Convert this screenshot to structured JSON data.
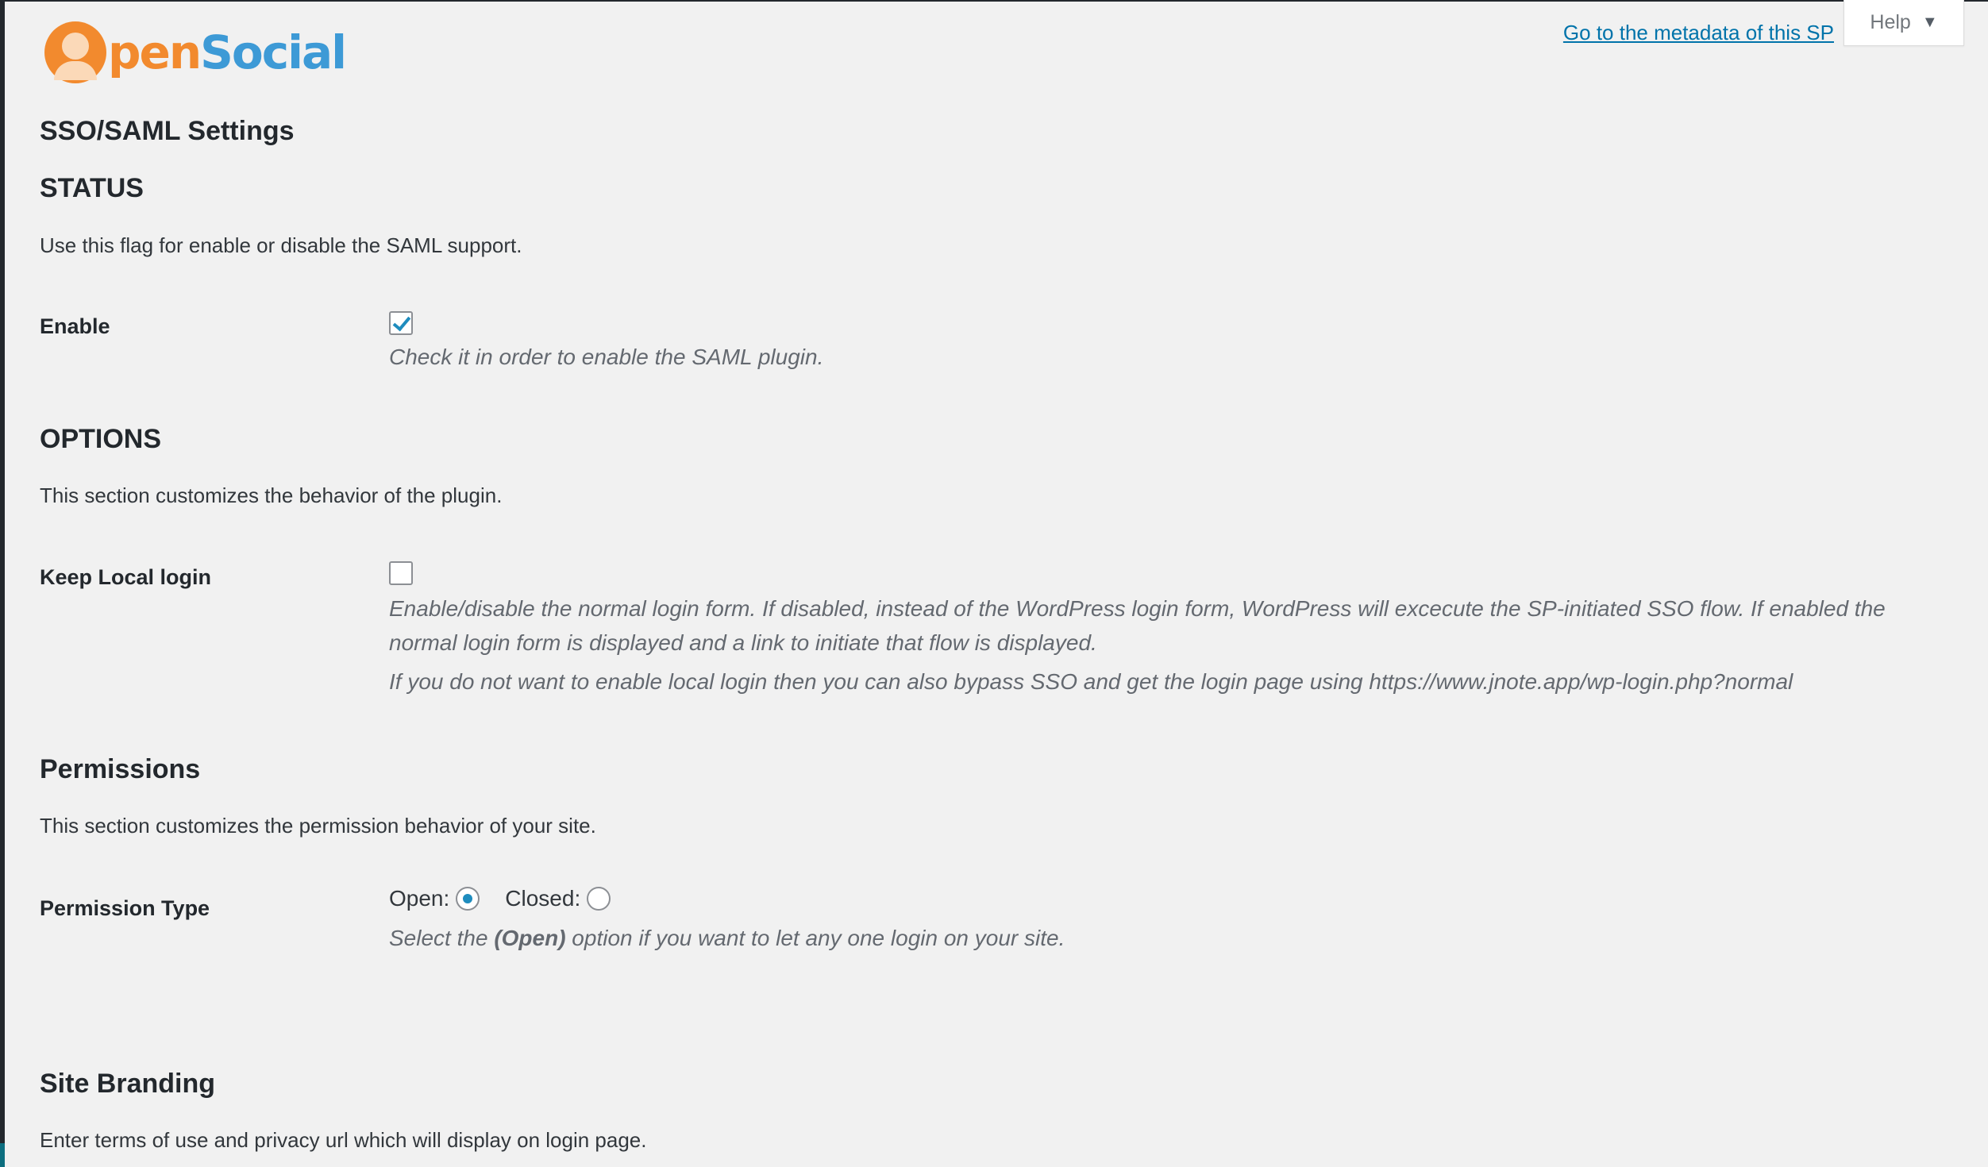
{
  "header": {
    "logo_text_pen": "pen",
    "logo_text_social": "Social",
    "metadata_link": "Go to the metadata of this SP",
    "help_label": "Help"
  },
  "page": {
    "title": "SSO/SAML Settings"
  },
  "sections": {
    "status": {
      "title": "STATUS",
      "description": "Use this flag for enable or disable the SAML support.",
      "enable": {
        "label": "Enable",
        "checked": true,
        "help": "Check it in order to enable the SAML plugin."
      }
    },
    "options": {
      "title": "OPTIONS",
      "description": "This section customizes the behavior of the plugin.",
      "keep_local_login": {
        "label": "Keep Local login",
        "checked": false,
        "help_1": "Enable/disable the normal login form. If disabled, instead of the WordPress login form, WordPress will excecute the SP-initiated SSO flow. If enabled the normal login form is displayed and a link to initiate that flow is displayed.",
        "help_2": "If you do not want to enable local login then you can also bypass SSO and get the login page using https://www.jnote.app/wp-login.php?normal"
      }
    },
    "permissions": {
      "title": "Permissions",
      "description": "This section customizes the permission behavior of your site.",
      "permission_type": {
        "label": "Permission Type",
        "option_open": "Open:",
        "option_closed": "Closed:",
        "selected": "Open",
        "help_prefix": "Select the ",
        "help_bold": "(Open)",
        "help_suffix": " option if you want to let any one login on your site."
      }
    },
    "site_branding": {
      "title": "Site Branding",
      "description": "Enter terms of use and privacy url which will display on login page."
    }
  },
  "colors": {
    "background": "#f1f1f1",
    "link": "#0073aa",
    "control_accent": "#1e8cbe",
    "logo_orange": "#f28a2e",
    "logo_blue": "#3d9ad6"
  },
  "icons": {
    "help_caret": "caret-down-icon",
    "logo": "opensocial-logo"
  }
}
